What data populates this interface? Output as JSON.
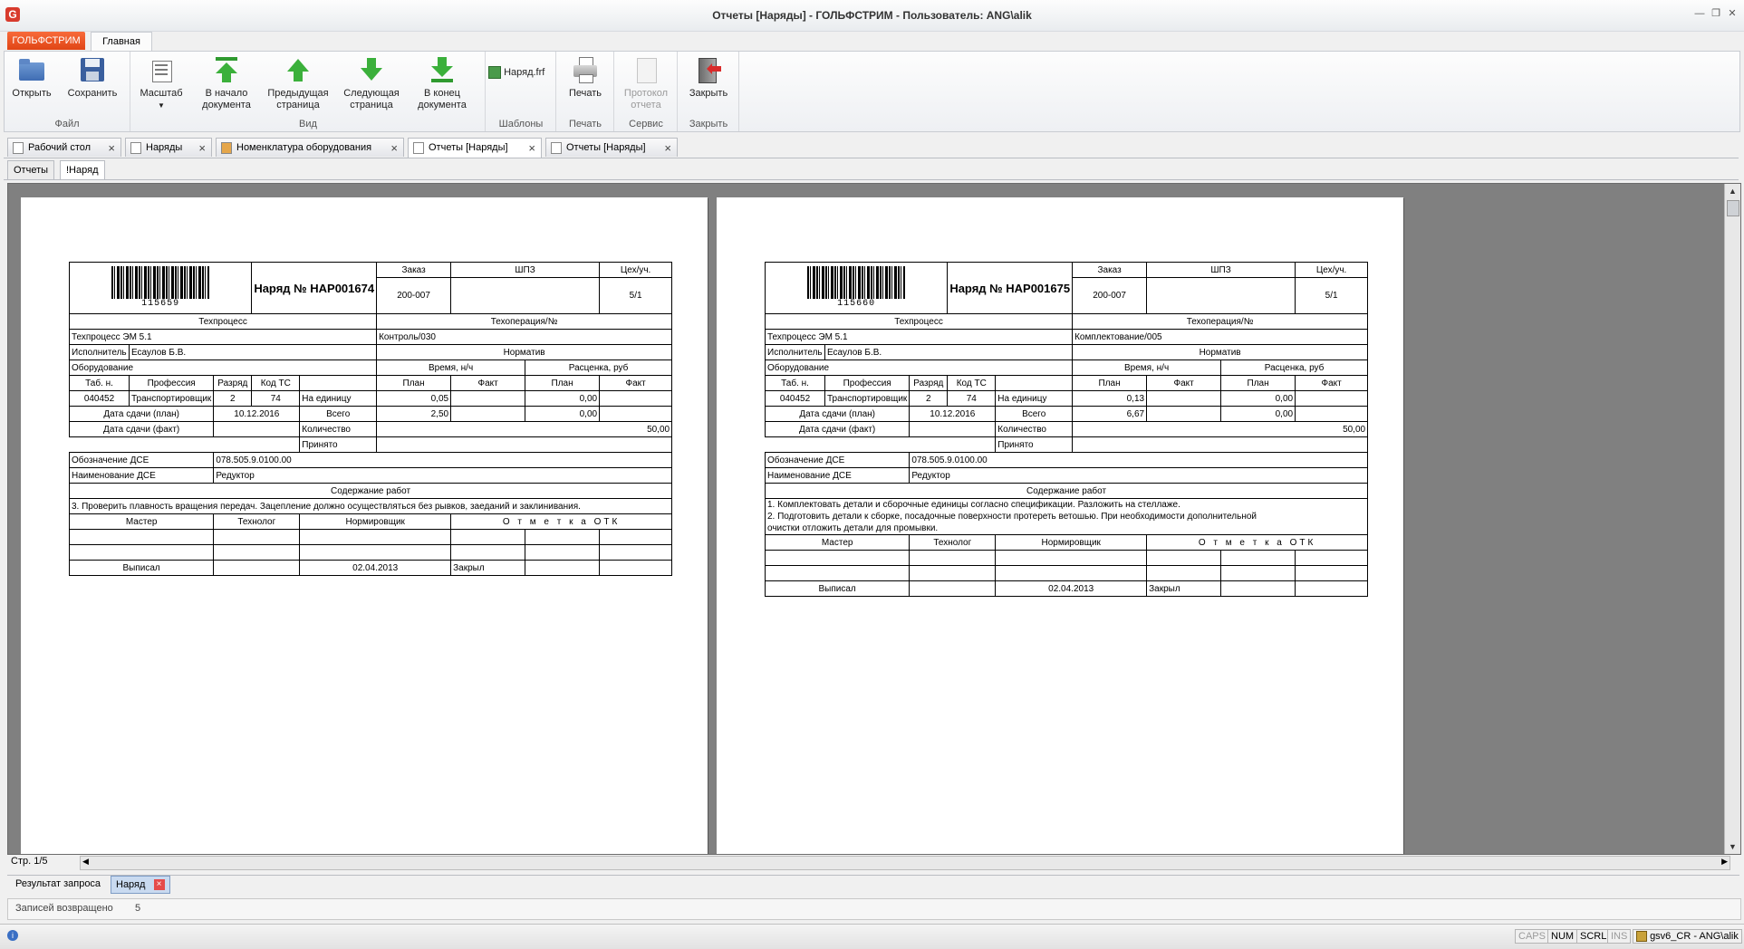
{
  "window": {
    "title": "Отчеты  [Наряды] - ГОЛЬФСТРИМ - Пользователь: ANG\\alik"
  },
  "ribbon": {
    "app_tab": "ГОЛЬФСТРИМ",
    "home_tab": "Главная",
    "groups": {
      "file": "Файл",
      "view": "Вид",
      "templates": "Шаблоны",
      "print": "Печать",
      "service": "Сервис",
      "close": "Закрыть"
    },
    "buttons": {
      "open": "Открыть",
      "save": "Сохранить",
      "scale": "Масштаб",
      "first_l1": "В начало",
      "first_l2": "документа",
      "prev_l1": "Предыдущая",
      "prev_l2": "страница",
      "next_l1": "Следующая",
      "next_l2": "страница",
      "last_l1": "В конец",
      "last_l2": "документа",
      "template_file": "Наряд.frf",
      "print": "Печать",
      "protocol_l1": "Протокол",
      "protocol_l2": "отчета",
      "close": "Закрыть"
    }
  },
  "doc_tabs": [
    "Рабочий стол",
    "Наряды",
    "Номенклатура оборудования",
    "Отчеты  [Наряды]",
    "Отчеты  [Наряды]"
  ],
  "sub_tabs": [
    "Отчеты",
    "!Наряд"
  ],
  "report": {
    "labels": {
      "order": "Заказ",
      "shpz": "ШПЗ",
      "shop": "Цех/уч.",
      "process": "Техпроцесс",
      "operation": "Техоперация/№",
      "executor": "Исполнитель",
      "norm": "Норматив",
      "equipment": "Оборудование",
      "time": "Время, н/ч",
      "rate": "Расценка, руб",
      "tab_no": "Таб. н.",
      "profession": "Профессия",
      "grade": "Разряд",
      "code": "Код ТС",
      "plan": "План",
      "fact": "Факт",
      "per_unit": "На единицу",
      "total": "Всего",
      "qty": "Количество",
      "accepted": "Принято",
      "due_plan": "Дата сдачи (план)",
      "due_fact": "Дата сдачи (факт)",
      "dse_code": "Обозначение ДСЕ",
      "dse_name": "Наименование ДСЕ",
      "work": "Содержание работ",
      "master": "Мастер",
      "technologist": "Технолог",
      "normer": "Нормировщик",
      "otk": "О т м е т к а   ОТК",
      "issued": "Выписал",
      "closed": "Закрыл"
    },
    "pages": [
      {
        "barcode": "115659",
        "title": "Наряд № НАР001674",
        "order": "200-007",
        "shpz": "",
        "shop": "5/1",
        "process": "Техпроцесс ЭМ 5.1",
        "operation": "Контроль/030",
        "executor": "Есаулов Б.В.",
        "tab_no": "040452",
        "profession": "Транспортировщик",
        "grade": "2",
        "code": "74",
        "unit_time": "0,05",
        "unit_rate": "0,00",
        "total_time": "2,50",
        "total_rate": "0,00",
        "due_plan": "10.12.2016",
        "qty": "50,00",
        "dse_code": "078.505.9.0100.00",
        "dse_name": "Редуктор",
        "work": [
          "3. Проверить плавность вращения передач. Зацепление должно осуществляться без рывков, заеданий и заклинивания."
        ],
        "issued_date": "02.04.2013"
      },
      {
        "barcode": "115660",
        "title": "Наряд № НАР001675",
        "order": "200-007",
        "shpz": "",
        "shop": "5/1",
        "process": "Техпроцесс ЭМ 5.1",
        "operation": "Комплектование/005",
        "executor": "Есаулов Б.В.",
        "tab_no": "040452",
        "profession": "Транспортировщик",
        "grade": "2",
        "code": "74",
        "unit_time": "0,13",
        "unit_rate": "0,00",
        "total_time": "6,67",
        "total_rate": "0,00",
        "due_plan": "10.12.2016",
        "qty": "50,00",
        "dse_code": "078.505.9.0100.00",
        "dse_name": "Редуктор",
        "work": [
          "1. Комплектовать детали и сборочные единицы согласно спецификации. Разложить на стеллаже.",
          "2. Подготовить детали к сборке, посадочные поверхности протереть ветошью. При необходимости дополнительной",
          "очистки отложить детали для промывки."
        ],
        "issued_date": "02.04.2013"
      }
    ]
  },
  "page_info": "Стр. 1/5",
  "bottom_tabs": [
    "Результат запроса",
    "Наряд"
  ],
  "records": {
    "label": "Записей возвращено",
    "value": "5"
  },
  "statusbar": {
    "caps": "CAPS",
    "num": "NUM",
    "scrl": "SCRL",
    "ins": "INS",
    "user": "gsv6_CR - ANG\\alik"
  },
  "colors": {
    "app_tab": "#e8501f",
    "viewer_bg": "#808080",
    "active_bottom_tab": "#c9daf0"
  }
}
